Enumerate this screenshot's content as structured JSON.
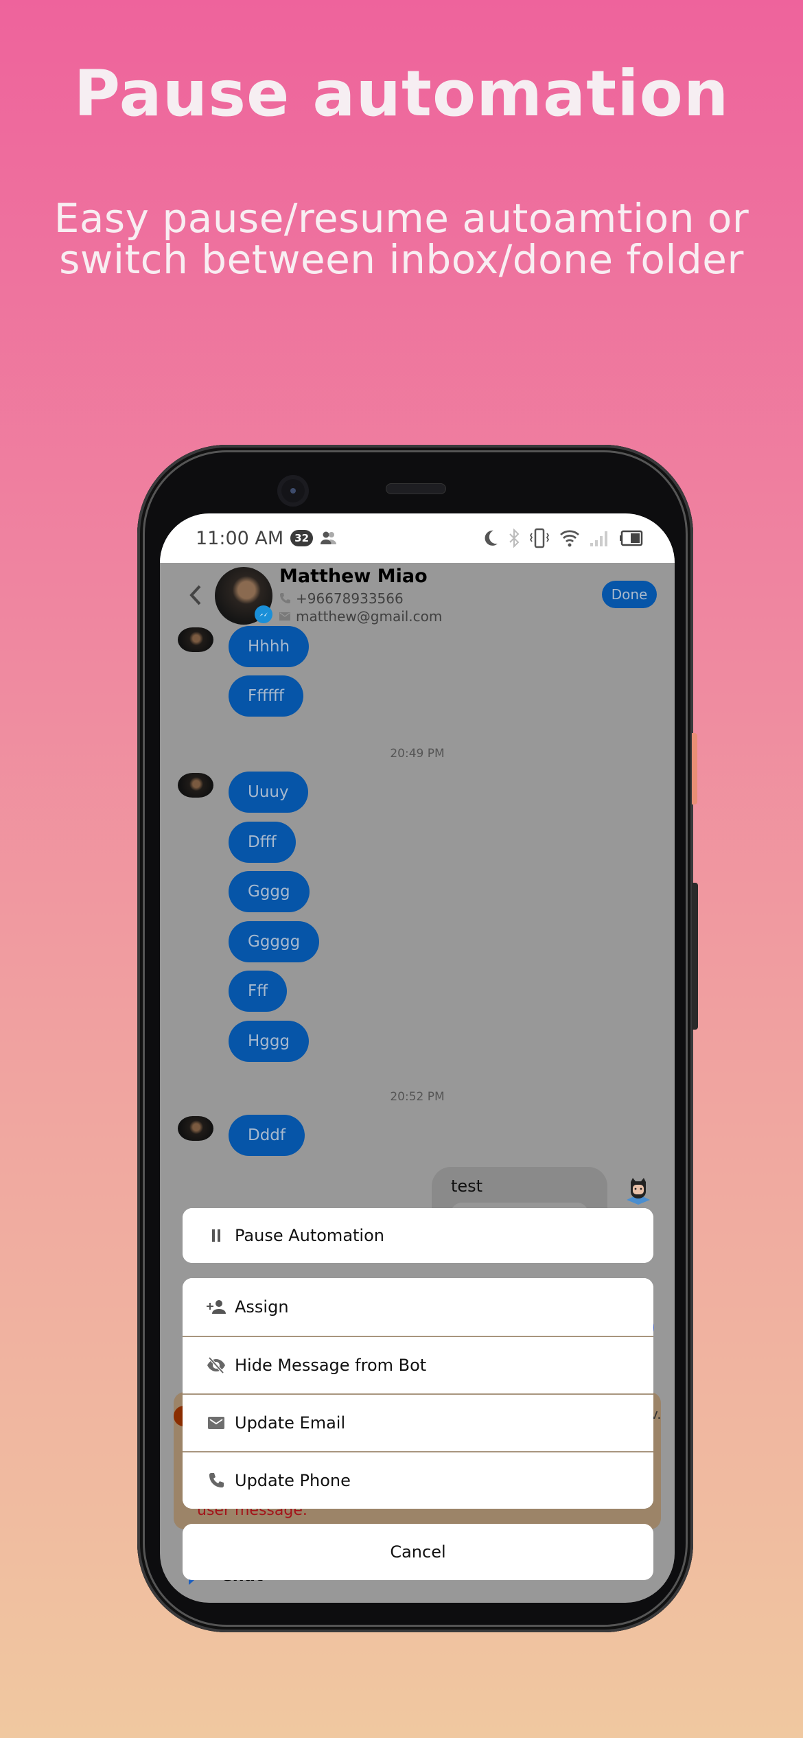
{
  "promo": {
    "title": "Pause automation",
    "subtitle_lines": [
      "Easy pause/resume autoamtion or",
      "switch between inbox/done folder"
    ]
  },
  "status_bar": {
    "time": "11:00 AM",
    "notification_count": "32",
    "icons": [
      "people-icon",
      "moon-icon",
      "bluetooth-icon",
      "vibrate-icon",
      "wifi-icon",
      "signal-icon",
      "battery-icon"
    ]
  },
  "header": {
    "contact_name": "Matthew Miao",
    "phone": "+96678933566",
    "email": "matthew@gmail.com",
    "channel_badge": "messenger-icon",
    "done_label": "Done"
  },
  "conversation": {
    "groups": [
      {
        "timestamp": "",
        "messages": [
          "Hhhh",
          "Ffffff"
        ]
      },
      {
        "timestamp": "20:49 PM",
        "messages": [
          "Uuuy",
          "Dfff",
          "Gggg",
          "Ggggg",
          "Fff",
          "Hggg"
        ]
      },
      {
        "timestamp": "20:52 PM",
        "messages": [
          "Dddf"
        ]
      }
    ],
    "outgoing": {
      "text": "test"
    },
    "partial_warning_text": "user message.",
    "partial_trailing": "v.",
    "bottom_tab_label": "Chat"
  },
  "colors": {
    "incoming_bubble": "#0655a8",
    "dim_overlay": "#989898",
    "warning_text": "#a3141a"
  },
  "action_sheet": {
    "primary": {
      "label": "Pause Automation",
      "icon": "pause-icon"
    },
    "items": [
      {
        "label": "Assign",
        "icon": "person-add-icon"
      },
      {
        "label": "Hide Message from Bot",
        "icon": "eye-off-icon"
      },
      {
        "label": "Update Email",
        "icon": "email-icon"
      },
      {
        "label": "Update Phone",
        "icon": "phone-icon"
      }
    ],
    "cancel_label": "Cancel"
  }
}
